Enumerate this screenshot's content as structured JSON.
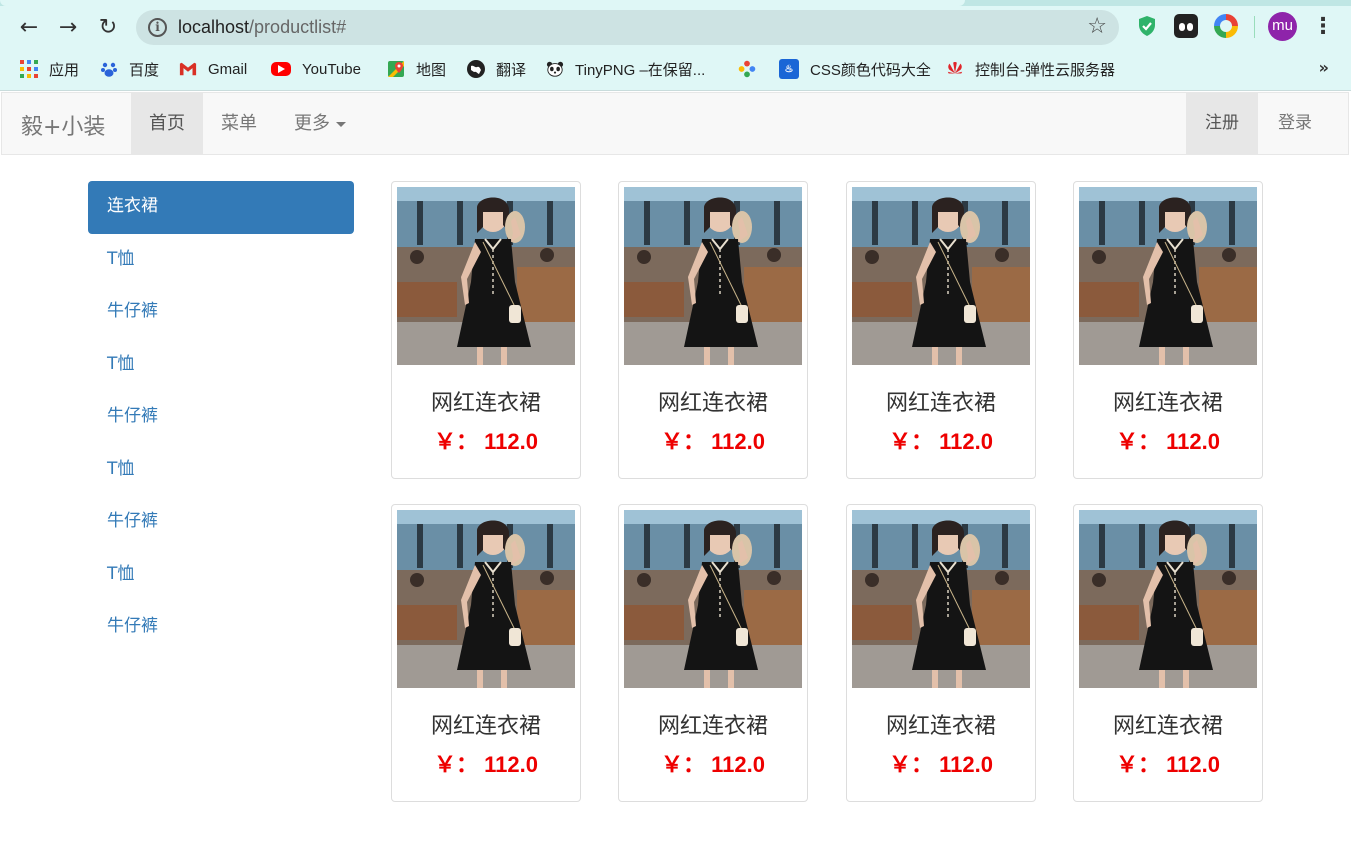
{
  "browser": {
    "url_host": "localhost",
    "url_path": "/productlist#",
    "profile_initials": "mu",
    "bookmarks": [
      {
        "label": "应用",
        "icon": "apps-grid-icon"
      },
      {
        "label": "百度",
        "icon": "baidu-paw-icon"
      },
      {
        "label": "Gmail",
        "icon": "gmail-icon"
      },
      {
        "label": "YouTube",
        "icon": "youtube-icon"
      },
      {
        "label": "地图",
        "icon": "maps-pin-icon"
      },
      {
        "label": "翻译",
        "icon": "translate-globe-icon"
      },
      {
        "label": "TinyPNG –在保留...",
        "icon": "panda-icon"
      },
      {
        "label": "",
        "icon": "pinwheel-icon"
      },
      {
        "label": "CSS颜色代码大全",
        "icon": "css-color-icon"
      },
      {
        "label": "控制台-弹性云服务器",
        "icon": "huawei-icon"
      }
    ],
    "bookmarks_overflow": "»"
  },
  "navbar": {
    "brand": "毅+小装",
    "items": [
      {
        "label": "首页",
        "active": true
      },
      {
        "label": "菜单",
        "active": false
      },
      {
        "label": "更多",
        "active": false,
        "dropdown": true
      }
    ],
    "right": [
      {
        "label": "注册",
        "active": true
      },
      {
        "label": "登录",
        "active": false
      }
    ]
  },
  "sidebar": {
    "categories": [
      {
        "label": "连衣裙",
        "active": true
      },
      {
        "label": "T恤"
      },
      {
        "label": "牛仔裤"
      },
      {
        "label": "T恤"
      },
      {
        "label": "牛仔裤"
      },
      {
        "label": "T恤"
      },
      {
        "label": "牛仔裤"
      },
      {
        "label": "T恤"
      },
      {
        "label": "牛仔裤"
      }
    ]
  },
  "products": [
    {
      "name": "网红连衣裙",
      "price": "￥： 112.0"
    },
    {
      "name": "网红连衣裙",
      "price": "￥： 112.0"
    },
    {
      "name": "网红连衣裙",
      "price": "￥： 112.0"
    },
    {
      "name": "网红连衣裙",
      "price": "￥： 112.0"
    },
    {
      "name": "网红连衣裙",
      "price": "￥： 112.0"
    },
    {
      "name": "网红连衣裙",
      "price": "￥： 112.0"
    },
    {
      "name": "网红连衣裙",
      "price": "￥： 112.0"
    },
    {
      "name": "网红连衣裙",
      "price": "￥： 112.0"
    }
  ],
  "colors": {
    "primary": "#337ab7",
    "price": "#ee0000",
    "navbar_bg": "#f8f8f8",
    "chrome_bg": "#dff7f6"
  }
}
